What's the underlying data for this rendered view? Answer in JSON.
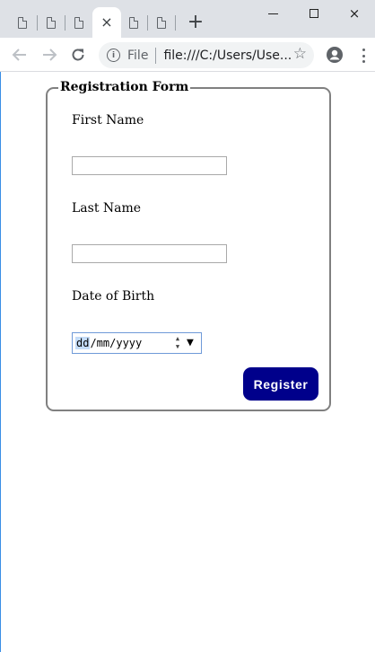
{
  "browser": {
    "tabs": [
      {
        "type": "document",
        "active": false
      },
      {
        "type": "document",
        "active": false
      },
      {
        "type": "document",
        "active": false
      },
      {
        "type": "document",
        "active": true
      },
      {
        "type": "document",
        "active": false
      },
      {
        "type": "document",
        "active": false
      }
    ],
    "new_tab_symbol": "+",
    "window_controls": {
      "minimize": "minimize-icon",
      "maximize": "maximize-icon",
      "close": "×"
    },
    "close_tab_symbol": "×",
    "address_bar": {
      "scheme_label": "File",
      "url": "file:///C:/Users/Use..."
    },
    "star_symbol": "☆"
  },
  "form": {
    "legend": "Registration Form",
    "first_name": {
      "label": "First Name",
      "value": ""
    },
    "last_name": {
      "label": "Last Name",
      "value": ""
    },
    "dob": {
      "label": "Date of Birth",
      "day_placeholder": "dd",
      "rest_placeholder": "/mm/yyyy",
      "spin_up": "▲",
      "spin_down": "▼",
      "dropdown": "▼"
    },
    "submit_label": "Register"
  },
  "colors": {
    "tab_bar": "#dee1e6",
    "submit_button": "#00008b",
    "fieldset_border": "#808080",
    "date_focus_border": "#6f9ad8"
  }
}
